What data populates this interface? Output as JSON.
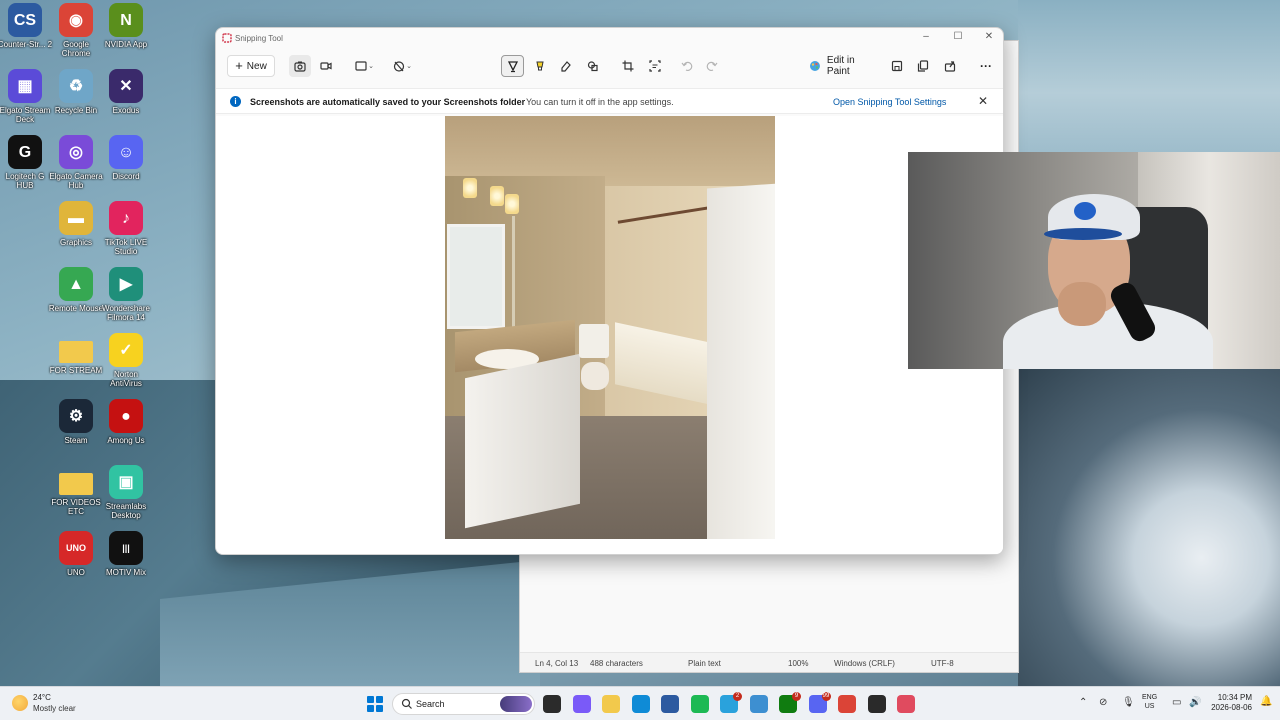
{
  "desktop": {
    "icons": [
      {
        "label": "Counter-Str... 2",
        "name": "desktop-icon-counter-strike-2",
        "color": "#2c5aa0",
        "glyph": "CS"
      },
      {
        "label": "Google Chrome",
        "name": "desktop-icon-google-chrome",
        "color": "#db4437",
        "glyph": "◉"
      },
      {
        "label": "NVIDIA App",
        "name": "desktop-icon-nvidia-app",
        "color": "#5a8f1c",
        "glyph": "N"
      },
      {
        "label": "Elgato Stream Deck",
        "name": "desktop-icon-elgato-stream-deck",
        "color": "#5b4bd8",
        "glyph": "▦"
      },
      {
        "label": "Recycle Bin",
        "name": "desktop-icon-recycle-bin",
        "color": "#6fa6c8",
        "glyph": "♻"
      },
      {
        "label": "Exodus",
        "name": "desktop-icon-exodus",
        "color": "#3a2a6b",
        "glyph": "✕"
      },
      {
        "label": "Logitech G HUB",
        "name": "desktop-icon-logitech-g-hub",
        "color": "#111111",
        "glyph": "G"
      },
      {
        "label": "Elgato Camera Hub",
        "name": "desktop-icon-elgato-camera-hub",
        "color": "#7a4bd8",
        "glyph": "◎"
      },
      {
        "label": "Discord",
        "name": "desktop-icon-discord",
        "color": "#5865f2",
        "glyph": "☺"
      },
      {
        "label": "Graphics",
        "name": "desktop-icon-graphics",
        "color": "#e0b53a",
        "glyph": "▬"
      },
      {
        "label": "TikTok LIVE Studio",
        "name": "desktop-icon-tiktok-live-studio",
        "color": "#e2245e",
        "glyph": "♪"
      },
      {
        "label": "Remote Mouse",
        "name": "desktop-icon-remote-mouse",
        "color": "#36a852",
        "glyph": "▲"
      },
      {
        "label": "Wondershare Filmora 14",
        "name": "desktop-icon-wondershare-filmora",
        "color": "#1f8f7a",
        "glyph": "▶"
      },
      {
        "label": "FOR STREAM",
        "name": "desktop-icon-folder-for-stream",
        "color": "#f2c94c",
        "glyph": ""
      },
      {
        "label": "Norton AntiVirus",
        "name": "desktop-icon-norton-antivirus",
        "color": "#f7d21f",
        "glyph": "✓"
      },
      {
        "label": "Steam",
        "name": "desktop-icon-steam",
        "color": "#1b2838",
        "glyph": "⚙"
      },
      {
        "label": "Among Us",
        "name": "desktop-icon-among-us",
        "color": "#c51111",
        "glyph": "●"
      },
      {
        "label": "FOR VIDEOS ETC",
        "name": "desktop-icon-folder-for-videos",
        "color": "#f2c94c",
        "glyph": ""
      },
      {
        "label": "Streamlabs Desktop",
        "name": "desktop-icon-streamlabs-desktop",
        "color": "#31c3a2",
        "glyph": "▣"
      },
      {
        "label": "UNO",
        "name": "desktop-icon-uno",
        "color": "#d62828",
        "glyph": "UNO"
      },
      {
        "label": "MOTIV Mix",
        "name": "desktop-icon-motiv-mix",
        "color": "#111111",
        "glyph": "|||"
      }
    ]
  },
  "snipping_tool": {
    "title": "Snipping Tool",
    "toolbar": {
      "new_label": "New",
      "edit_in_paint_label": "Edit in Paint",
      "tools": [
        "screenshot-mode-icon",
        "video-mode-icon",
        "snip-shape-icon",
        "delay-timer-icon",
        "pen-icon",
        "highlighter-icon",
        "eraser-icon",
        "shapes-icon",
        "crop-icon",
        "text-actions-icon",
        "undo-icon",
        "redo-icon",
        "paint-icon",
        "save-icon",
        "copy-icon",
        "share-icon",
        "more-icon"
      ]
    },
    "info_bar": {
      "message": "Screenshots are automatically saved to your Screenshots folder",
      "sub": "You can turn it off in the app settings.",
      "link": "Open Snipping Tool Settings"
    },
    "canvas": {
      "image_description": "bathroom-photo"
    }
  },
  "notepad": {
    "status": {
      "position": "Ln 4, Col 13",
      "characters": "488 characters",
      "format": "Plain text",
      "zoom": "100%",
      "line_endings": "Windows (CRLF)",
      "encoding": "UTF-8"
    }
  },
  "taskbar": {
    "weather_temp": "24°C",
    "weather_desc": "Mostly clear",
    "search_placeholder": "Search",
    "language_line1": "ENG",
    "language_line2": "US",
    "time": "10:34 PM",
    "date": "2026-08-06",
    "apps": [
      {
        "name": "task-view-icon",
        "color": "#2b2b2b",
        "badge": ""
      },
      {
        "name": "copilot-icon",
        "color": "#7a5af8",
        "badge": ""
      },
      {
        "name": "file-explorer-icon",
        "color": "#f2c94c",
        "badge": ""
      },
      {
        "name": "edge-icon",
        "color": "#0f8bd6",
        "badge": ""
      },
      {
        "name": "counter-strike-taskbar-icon",
        "color": "#2c5aa0",
        "badge": ""
      },
      {
        "name": "spotify-icon",
        "color": "#1db954",
        "badge": ""
      },
      {
        "name": "telegram-icon",
        "color": "#2aa2dc",
        "badge": "2"
      },
      {
        "name": "notepad-icon",
        "color": "#3d8fd1",
        "badge": ""
      },
      {
        "name": "xbox-icon",
        "color": "#107c10",
        "badge": "9"
      },
      {
        "name": "discord-taskbar-icon",
        "color": "#5865f2",
        "badge": "99"
      },
      {
        "name": "chrome-taskbar-icon",
        "color": "#db4437",
        "badge": ""
      },
      {
        "name": "obs-icon",
        "color": "#2a2a2a",
        "badge": ""
      },
      {
        "name": "snipping-tool-taskbar-icon",
        "color": "#e04b5f",
        "badge": ""
      }
    ]
  },
  "webcam": {
    "description": "webcam-overlay"
  }
}
